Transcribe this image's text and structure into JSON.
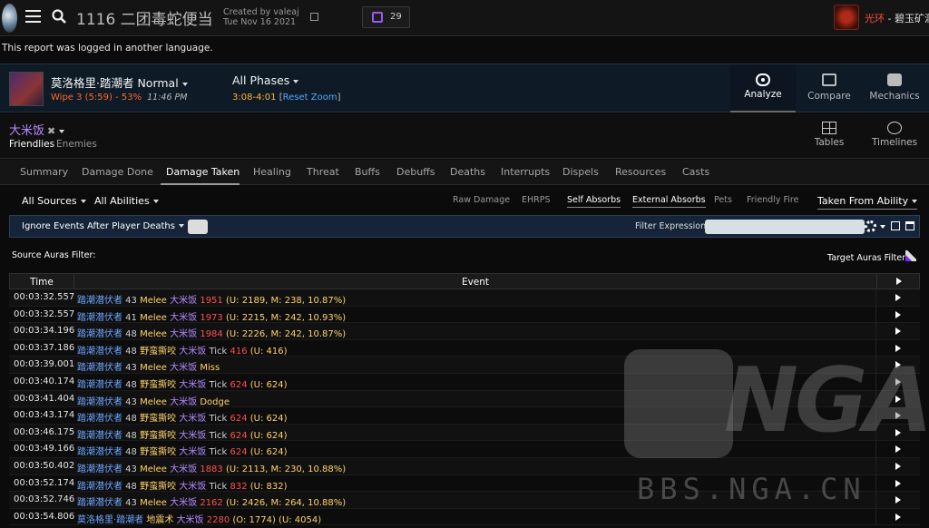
{
  "header": {
    "report_title": "1116 二团毒蛇便当",
    "created_by": "Created by valeaj",
    "created_date": "Tue Nov 16 2021",
    "twitch_count": "29",
    "character_name": "光环",
    "character_realm": " - 碧玉矿洞"
  },
  "notice": "This report was logged in another language.",
  "fight": {
    "name": "莫洛格里·踏潮者 Normal",
    "wipe": "Wipe 3 (5:59) - 53%",
    "time": "11:46 PM",
    "phases": "All Phases",
    "time_range": "3:08-4:01",
    "reset_open": " [",
    "reset_zoom": "Reset Zoom",
    "reset_close": "]"
  },
  "top_nav": [
    {
      "label": "Analyze",
      "icon": "eye-icon"
    },
    {
      "label": "Compare",
      "icon": "compare-icon"
    },
    {
      "label": "Mechanics",
      "icon": "puzzle-icon"
    }
  ],
  "actor": {
    "name": "大米饭",
    "remove": "✖",
    "friendlies": "Friendlies",
    "enemies": "Enemies"
  },
  "view_nav": [
    {
      "label": "Tables",
      "icon": "tables-icon"
    },
    {
      "label": "Timelines",
      "icon": "clock-icon"
    }
  ],
  "tabs": [
    "Summary",
    "Damage Done",
    "Damage Taken",
    "Healing",
    "Threat",
    "Buffs",
    "Debuffs",
    "Deaths",
    "Interrupts",
    "Dispels",
    "Resources",
    "Casts"
  ],
  "active_tab": "Damage Taken",
  "filters": {
    "sources": "All Sources",
    "abilities": "All Abilities",
    "options": [
      "Raw Damage",
      "EHRPS",
      "Self Absorbs",
      "External Absorbs",
      "Pets",
      "Friendly Fire"
    ],
    "options_on": [
      "Self Absorbs",
      "External Absorbs"
    ],
    "taken_from": "Taken From Ability"
  },
  "options_bar": {
    "ignore_label": "Ignore Events After Player Deaths",
    "filter_label": "Filter Expression:",
    "filter_value": ""
  },
  "auras": {
    "source": "Source Auras Filter:",
    "target": "Target Auras Filter:"
  },
  "table": {
    "col_time": "Time",
    "col_event": "Event",
    "rows": [
      {
        "time": "00:03:32.557",
        "src": "踏潮潜伏者",
        "lvl": " 43 ",
        "abil": "Melee",
        "tgt": " 大米饭 ",
        "amt": "1951",
        "detail": " (U: 2189, M: 238, 10.87%)"
      },
      {
        "time": "00:03:32.557",
        "src": "踏潮潜伏者",
        "lvl": " 41 ",
        "abil": "Melee",
        "tgt": " 大米饭 ",
        "amt": "1973",
        "detail": " (U: 2215, M: 242, 10.93%)"
      },
      {
        "time": "00:03:34.196",
        "src": "踏潮潜伏者",
        "lvl": " 48 ",
        "abil": "Melee",
        "tgt": " 大米饭 ",
        "amt": "1984",
        "detail": " (U: 2226, M: 242, 10.87%)"
      },
      {
        "time": "00:03:37.186",
        "src": "踏潮潜伏者",
        "lvl": " 48 ",
        "abil": "野蛮撕咬",
        "tgt": " 大米饭 ",
        "extra": "Tick ",
        "amt": "416",
        "detail": " (U: 416)"
      },
      {
        "time": "00:03:39.001",
        "src": "踏潮潜伏者",
        "lvl": " 43 ",
        "abil": "Melee",
        "tgt": " 大米饭 ",
        "miss": "Miss"
      },
      {
        "time": "00:03:40.174",
        "src": "踏潮潜伏者",
        "lvl": " 48 ",
        "abil": "野蛮撕咬",
        "tgt": " 大米饭 ",
        "extra": "Tick ",
        "amt": "624",
        "detail": " (U: 624)"
      },
      {
        "time": "00:03:41.404",
        "src": "踏潮潜伏者",
        "lvl": " 43 ",
        "abil": "Melee",
        "tgt": " 大米饭 ",
        "miss": "Dodge"
      },
      {
        "time": "00:03:43.174",
        "src": "踏潮潜伏者",
        "lvl": " 48 ",
        "abil": "野蛮撕咬",
        "tgt": " 大米饭 ",
        "extra": "Tick ",
        "amt": "624",
        "detail": " (U: 624)"
      },
      {
        "time": "00:03:46.175",
        "src": "踏潮潜伏者",
        "lvl": " 48 ",
        "abil": "野蛮撕咬",
        "tgt": " 大米饭 ",
        "extra": "Tick ",
        "amt": "624",
        "detail": " (U: 624)"
      },
      {
        "time": "00:03:49.166",
        "src": "踏潮潜伏者",
        "lvl": " 48 ",
        "abil": "野蛮撕咬",
        "tgt": " 大米饭 ",
        "extra": "Tick ",
        "amt": "624",
        "detail": " (U: 624)"
      },
      {
        "time": "00:03:50.402",
        "src": "踏潮潜伏者",
        "lvl": " 43 ",
        "abil": "Melee",
        "tgt": " 大米饭 ",
        "amt": "1883",
        "detail": " (U: 2113, M: 230, 10.88%)"
      },
      {
        "time": "00:03:52.174",
        "src": "踏潮潜伏者",
        "lvl": " 48 ",
        "abil": "野蛮撕咬",
        "tgt": " 大米饭 ",
        "extra": "Tick ",
        "amt": "832",
        "detail": " (U: 832)"
      },
      {
        "time": "00:03:52.746",
        "src": "踏潮潜伏者",
        "lvl": " 43 ",
        "abil": "Melee",
        "tgt": " 大米饭 ",
        "amt": "2162",
        "detail": " (U: 2426, M: 264, 10.88%)"
      },
      {
        "time": "00:03:54.806",
        "src": "莫洛格里·踏潮者",
        "lvl": " ",
        "abil": "地震术",
        "tgt": " 大米饭 ",
        "amt": "2280",
        "detail": " (O: 1774) (U: 4054)"
      }
    ]
  },
  "watermark": {
    "logo": "NGA",
    "url": "BBS.NGA.CN"
  }
}
